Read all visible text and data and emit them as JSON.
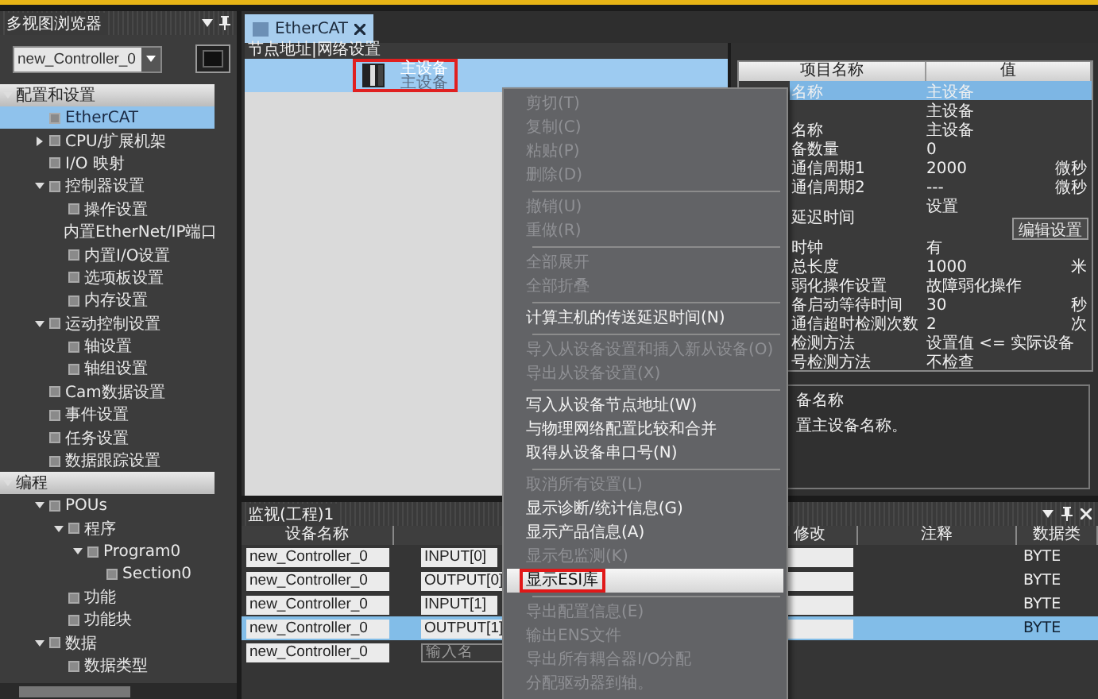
{
  "sidebar": {
    "title": "多视图浏览器",
    "controller": "new_Controller_0",
    "sections": [
      {
        "label": "配置和设置",
        "expanded": true,
        "items": [
          {
            "label": "EtherCAT",
            "selected": true
          },
          {
            "label": "CPU/扩展机架",
            "selected": false,
            "expanded": false
          },
          {
            "label": "I/O 映射",
            "selected": false
          },
          {
            "label": "控制器设置",
            "selected": false,
            "expanded": true,
            "children": [
              {
                "label": "操作设置",
                "selected": false
              },
              {
                "label": "内置EtherNet/IP端口",
                "selected": false
              },
              {
                "label": "内置I/O设置",
                "selected": false
              },
              {
                "label": "选项板设置",
                "selected": false
              },
              {
                "label": "内存设置",
                "selected": false
              }
            ]
          },
          {
            "label": "运动控制设置",
            "selected": false,
            "expanded": true,
            "children": [
              {
                "label": "轴设置",
                "selected": false
              },
              {
                "label": "轴组设置",
                "selected": false
              }
            ]
          },
          {
            "label": "Cam数据设置",
            "selected": false
          },
          {
            "label": "事件设置",
            "selected": false
          },
          {
            "label": "任务设置",
            "selected": false
          },
          {
            "label": "数据跟踪设置",
            "selected": false
          }
        ]
      },
      {
        "label": "编程",
        "expanded": true,
        "items": [
          {
            "label": "POUs",
            "selected": false,
            "expanded": true,
            "children": [
              {
                "label": "程序",
                "selected": false,
                "expanded": true,
                "children": [
                  {
                    "label": "Program0",
                    "selected": false,
                    "expanded": true,
                    "children": [
                      {
                        "label": "Section0",
                        "selected": false
                      }
                    ]
                  }
                ]
              },
              {
                "label": "功能",
                "selected": false
              },
              {
                "label": "功能块",
                "selected": false
              }
            ]
          },
          {
            "label": "数据",
            "selected": false,
            "expanded": true,
            "children": [
              {
                "label": "数据类型",
                "selected": false
              }
            ]
          }
        ]
      }
    ]
  },
  "editor": {
    "tabs": [
      {
        "label": "EtherCAT",
        "selected": true
      }
    ],
    "header": "节点地址|网络设置",
    "device": {
      "name": "主设备",
      "model": "主设备",
      "selected": true
    }
  },
  "properties": {
    "columns": [
      "项目名称",
      "值"
    ],
    "rows": [
      {
        "name": "名称",
        "value": "主设备",
        "selected": true
      },
      {
        "value": "主设备",
        "selected": false
      },
      {
        "name": "名称",
        "value": "主设备",
        "selected": false
      },
      {
        "name": "备数量",
        "value": "0",
        "selected": false
      },
      {
        "name": "通信周期1",
        "value": "2000",
        "unit": "微秒",
        "selected": false
      },
      {
        "name": "通信周期2",
        "value": "---",
        "unit": "微秒",
        "selected": false
      },
      {
        "kind": "button",
        "name": "延迟时间",
        "value": "设置",
        "button": "编辑设置",
        "selected": false
      },
      {
        "name": "时钟",
        "value": "有",
        "selected": false
      },
      {
        "name": "总长度",
        "value": "1000",
        "unit": "米",
        "selected": false
      },
      {
        "name": "弱化操作设置",
        "value": "故障弱化操作",
        "selected": false
      },
      {
        "name": "备启动等待时间",
        "value": "30",
        "unit": "秒",
        "selected": false
      },
      {
        "name": "通信超时检测次数",
        "value": "2",
        "unit": "次",
        "selected": false
      },
      {
        "name": "检测方法",
        "value": "设置值 <= 实际设备",
        "selected": false
      },
      {
        "name": "号检测方法",
        "value": "不检查",
        "selected": false
      }
    ],
    "description": {
      "title": "备名称",
      "text": "置主设备名称。"
    }
  },
  "context_menu": [
    {
      "kind": "item",
      "label": "剪切(T)",
      "disabled": true,
      "selected": false
    },
    {
      "kind": "item",
      "label": "复制(C)",
      "disabled": true,
      "selected": false
    },
    {
      "kind": "item",
      "label": "粘贴(P)",
      "disabled": true,
      "selected": false
    },
    {
      "kind": "item",
      "label": "删除(D)",
      "disabled": true,
      "selected": false
    },
    {
      "kind": "separator"
    },
    {
      "kind": "item",
      "label": "撤销(U)",
      "disabled": true,
      "selected": false
    },
    {
      "kind": "item",
      "label": "重做(R)",
      "disabled": true,
      "selected": false
    },
    {
      "kind": "separator"
    },
    {
      "kind": "item",
      "label": "全部展开",
      "disabled": true,
      "selected": false
    },
    {
      "kind": "item",
      "label": "全部折叠",
      "disabled": true,
      "selected": false
    },
    {
      "kind": "separator"
    },
    {
      "kind": "item",
      "label": "计算主机的传送延迟时间(N)",
      "disabled": false,
      "selected": false
    },
    {
      "kind": "separator"
    },
    {
      "kind": "item",
      "label": "导入从设备设置和插入新从设备(O)",
      "disabled": true,
      "selected": false
    },
    {
      "kind": "item",
      "label": "导出从设备设置(X)",
      "disabled": true,
      "selected": false
    },
    {
      "kind": "separator"
    },
    {
      "kind": "item",
      "label": "写入从设备节点地址(W)",
      "disabled": false,
      "selected": false
    },
    {
      "kind": "item",
      "label": "与物理网络配置比较和合并",
      "disabled": false,
      "selected": false
    },
    {
      "kind": "item",
      "label": "取得从设备串口号(N)",
      "disabled": false,
      "selected": false
    },
    {
      "kind": "separator"
    },
    {
      "kind": "item",
      "label": "取消所有设置(L)",
      "disabled": true,
      "selected": false
    },
    {
      "kind": "item",
      "label": "显示诊断/统计信息(G)",
      "disabled": false,
      "selected": false
    },
    {
      "kind": "item",
      "label": "显示产品信息(A)",
      "disabled": false,
      "selected": false
    },
    {
      "kind": "item",
      "label": "显示包监测(K)",
      "disabled": true,
      "selected": false
    },
    {
      "kind": "item",
      "label": "显示ESI库",
      "disabled": false,
      "selected": true
    },
    {
      "kind": "separator"
    },
    {
      "kind": "item",
      "label": "导出配置信息(E)",
      "disabled": true,
      "selected": false
    },
    {
      "kind": "item",
      "label": "输出ENS文件",
      "disabled": true,
      "selected": false
    },
    {
      "kind": "item",
      "label": "导出所有耦合器I/O分配",
      "disabled": true,
      "selected": false
    },
    {
      "kind": "item",
      "label": "分配驱动器到轴。",
      "disabled": true,
      "selected": false
    }
  ],
  "watch": {
    "title": "监视(工程)1",
    "columns": [
      "设备名称",
      "修改",
      "注释",
      "数据类"
    ],
    "rows": [
      {
        "device": "new_Controller_0",
        "name": "INPUT[0]",
        "type": "BYTE",
        "selected": false
      },
      {
        "device": "new_Controller_0",
        "name": "OUTPUT[0]",
        "type": "BYTE",
        "selected": false
      },
      {
        "device": "new_Controller_0",
        "name": "INPUT[1]",
        "type": "BYTE",
        "selected": false
      },
      {
        "device": "new_Controller_0",
        "name": "OUTPUT[1]",
        "type": "BYTE",
        "selected": true
      },
      {
        "device": "new_Controller_0",
        "placeholder": "输入名",
        "selected": false
      }
    ]
  }
}
